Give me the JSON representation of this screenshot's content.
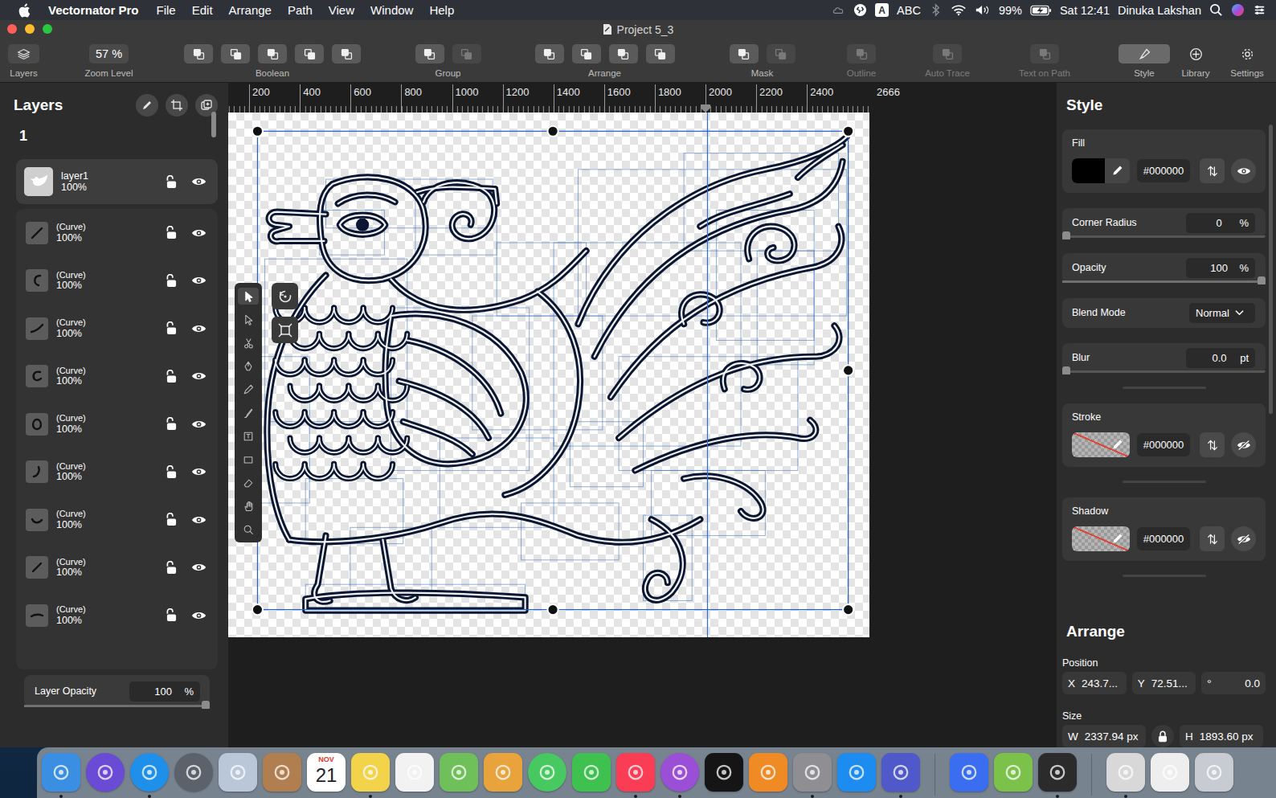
{
  "menubar": {
    "app": "Vectornator Pro",
    "menus": [
      "File",
      "Edit",
      "Arrange",
      "Path",
      "View",
      "Window",
      "Help"
    ],
    "input_badge": "A",
    "input": "ABC",
    "battery": "99%",
    "charging": true,
    "clock": "Sat 12:41",
    "user": "Dinuka Lakshan"
  },
  "window": {
    "title": "Project 5_3"
  },
  "toolbar": {
    "layers": {
      "label": "Layers"
    },
    "zoom": {
      "label": "Zoom Level",
      "value": "57 %"
    },
    "groups": [
      {
        "label": "Boolean",
        "buttons": [
          {
            "disabled": false
          },
          {
            "disabled": false
          },
          {
            "disabled": false
          },
          {
            "disabled": false
          },
          {
            "disabled": false
          }
        ]
      },
      {
        "label": "Group",
        "buttons": [
          {
            "disabled": false
          },
          {
            "disabled": true
          }
        ]
      },
      {
        "label": "Arrange",
        "buttons": [
          {
            "disabled": false
          },
          {
            "disabled": false
          },
          {
            "disabled": false
          },
          {
            "disabled": false
          }
        ]
      },
      {
        "label": "Mask",
        "buttons": [
          {
            "disabled": false
          },
          {
            "disabled": true
          }
        ]
      },
      {
        "label": "Outline",
        "buttons": [
          {
            "disabled": true
          }
        ]
      },
      {
        "label": "Auto Trace",
        "buttons": [
          {
            "disabled": true
          }
        ]
      },
      {
        "label": "Text on Path",
        "buttons": [
          {
            "disabled": true
          }
        ]
      }
    ],
    "tabs": [
      {
        "label": "Style",
        "selected": true
      },
      {
        "label": "Library",
        "selected": false
      },
      {
        "label": "Settings",
        "selected": false
      }
    ]
  },
  "layers_panel": {
    "title": "Layers",
    "artboard": "1",
    "layer": {
      "name": "layer1",
      "opacity": "100%",
      "locked": false,
      "visible": true
    },
    "items": [
      {
        "name": "(Curve)",
        "opacity": "100%",
        "locked": false,
        "visible": true
      },
      {
        "name": "(Curve)",
        "opacity": "100%",
        "locked": false,
        "visible": true
      },
      {
        "name": "(Curve)",
        "opacity": "100%",
        "locked": false,
        "visible": true
      },
      {
        "name": "(Curve)",
        "opacity": "100%",
        "locked": false,
        "visible": true
      },
      {
        "name": "(Curve)",
        "opacity": "100%",
        "locked": false,
        "visible": true
      },
      {
        "name": "(Curve)",
        "opacity": "100%",
        "locked": false,
        "visible": true
      },
      {
        "name": "(Curve)",
        "opacity": "100%",
        "locked": false,
        "visible": true
      },
      {
        "name": "(Curve)",
        "opacity": "100%",
        "locked": false,
        "visible": true
      },
      {
        "name": "(Curve)",
        "opacity": "100%",
        "locked": false,
        "visible": true
      }
    ],
    "layer_opacity": {
      "label": "Layer Opacity",
      "value": "100",
      "unit": "%",
      "level": 1
    }
  },
  "ruler": {
    "ticks": [
      "200",
      "400",
      "600",
      "800",
      "1000",
      "1200",
      "1400",
      "1600",
      "1800",
      "2000",
      "2200",
      "2400"
    ],
    "end": "2666",
    "guide": "2000"
  },
  "tools": [
    {
      "selected": true
    },
    {
      "selected": false
    },
    {
      "selected": false
    },
    {
      "selected": false
    },
    {
      "selected": false
    },
    {
      "selected": false
    },
    {
      "selected": false
    },
    {
      "selected": false
    },
    {
      "selected": false
    },
    {
      "selected": false
    },
    {
      "selected": false
    }
  ],
  "style": {
    "title": "Style",
    "fill": {
      "label": "Fill",
      "hex": "#000000",
      "none": false,
      "visible": true
    },
    "corner_radius": {
      "label": "Corner Radius",
      "value": "0",
      "unit": "%",
      "level": 0
    },
    "opacity": {
      "label": "Opacity",
      "value": "100",
      "unit": "%",
      "level": 1
    },
    "blend_mode": {
      "label": "Blend Mode",
      "value": "Normal"
    },
    "blur": {
      "label": "Blur",
      "value": "0.0",
      "unit": "pt",
      "level": 0
    },
    "stroke": {
      "label": "Stroke",
      "hex": "#000000",
      "none": true,
      "visible": false
    },
    "shadow": {
      "label": "Shadow",
      "hex": "#000000",
      "none": true,
      "visible": false
    }
  },
  "arrange": {
    "title": "Arrange",
    "position_label": "Position",
    "x": {
      "label": "X",
      "value": "243.7..."
    },
    "y": {
      "label": "Y",
      "value": "72.51..."
    },
    "rotation": {
      "label": "°",
      "value": "0.0"
    },
    "size_label": "Size",
    "w": {
      "label": "W",
      "value": "2337.94 px"
    },
    "h": {
      "label": "H",
      "value": "1893.60 px"
    },
    "locked": true
  },
  "dock": [
    {
      "kind": "square",
      "color": "#3b8fe2",
      "running": true
    },
    {
      "kind": "round",
      "color": "#6a4bd6",
      "running": false
    },
    {
      "kind": "round",
      "color": "#1f90ea",
      "running": true
    },
    {
      "kind": "round",
      "color": "#5b626c",
      "running": false
    },
    {
      "kind": "square",
      "color": "#b9c7d8",
      "running": false
    },
    {
      "kind": "square",
      "color": "#b07e4f",
      "running": false
    },
    {
      "kind": "calendar",
      "color": "#ffffff",
      "month": "NOV",
      "day": "21",
      "running": false
    },
    {
      "kind": "square",
      "color": "#f3d34a",
      "running": true
    },
    {
      "kind": "square",
      "color": "#f2f2f2",
      "running": false
    },
    {
      "kind": "square",
      "color": "#6fbf5a",
      "running": false
    },
    {
      "kind": "square",
      "color": "#e9a33c",
      "running": false
    },
    {
      "kind": "round",
      "color": "#47c860",
      "running": false
    },
    {
      "kind": "square",
      "color": "#3ec14e",
      "running": false
    },
    {
      "kind": "square",
      "color": "#fa3c55",
      "running": true
    },
    {
      "kind": "round",
      "color": "#9b4fd6",
      "running": true
    },
    {
      "kind": "square",
      "color": "#151515",
      "running": false
    },
    {
      "kind": "square",
      "color": "#f08a24",
      "running": false
    },
    {
      "kind": "square",
      "color": "#8e8e93",
      "running": true
    },
    {
      "kind": "square",
      "color": "#1d8cf0",
      "running": false
    },
    {
      "kind": "square",
      "color": "#5059c9",
      "running": true
    },
    {
      "kind": "divider",
      "color": "#5f656d",
      "running": false
    },
    {
      "kind": "square",
      "color": "#3a6df0",
      "running": false
    },
    {
      "kind": "square",
      "color": "#7cc24a",
      "running": false
    },
    {
      "kind": "square",
      "color": "#2b2b2b",
      "running": true
    },
    {
      "kind": "divider",
      "color": "#5f656d",
      "running": false
    },
    {
      "kind": "square",
      "color": "#d8d8d8",
      "running": true
    },
    {
      "kind": "square",
      "color": "#eeeeee",
      "running": false
    },
    {
      "kind": "square",
      "color": "#c8ccd2",
      "running": false
    }
  ]
}
